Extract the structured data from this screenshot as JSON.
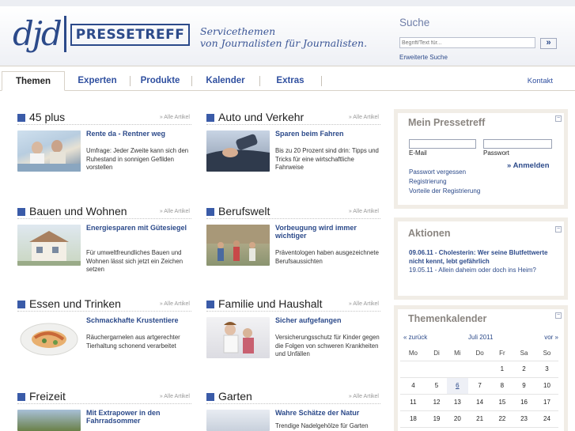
{
  "header": {
    "logo_djd": "djd",
    "logo_box": "PRESSETREFF",
    "tagline_1": "Servicethemen",
    "tagline_2": "von Journalisten für Journalisten.",
    "search_title": "Suche",
    "search_placeholder": "Begriff/Text für...",
    "search_button": "»",
    "extended_search": "Erweiterte Suche"
  },
  "nav": {
    "tabs": [
      {
        "label": "Themen"
      },
      {
        "label": "Experten"
      },
      {
        "label": "Produkte"
      },
      {
        "label": "Kalender"
      },
      {
        "label": "Extras"
      }
    ],
    "contact": "Kontakt"
  },
  "sections": [
    {
      "title": "45 plus",
      "all": "» Alle Artikel",
      "article_title": "Rente da - Rentner weg",
      "article_text": "Umfrage: Jeder Zweite kann sich den Ruhestand in sonnigen Gefilden vorstellen"
    },
    {
      "title": "Auto und Verkehr",
      "all": "» Alle Artikel",
      "article_title": "Sparen beim Fahren",
      "article_text": "Bis zu 20 Prozent sind drin: Tipps und Tricks für eine wirtschaftliche Fahrweise"
    },
    {
      "title": "Bauen und Wohnen",
      "all": "» Alle Artikel",
      "article_title": "Energiesparen mit Gütesiegel",
      "article_text": "Für umweltfreundliches Bauen und Wohnen lässt sich jetzt ein Zeichen setzen"
    },
    {
      "title": "Berufswelt",
      "all": "» Alle Artikel",
      "article_title": "Vorbeugung wird immer wichtiger",
      "article_text": "Präventologen haben ausgezeichnete Berufsaussichten"
    },
    {
      "title": "Essen und Trinken",
      "all": "» Alle Artikel",
      "article_title": "Schmackhafte Krustentiere",
      "article_text": "Räuchergarnelen aus artgerechter Tierhaltung schonend verarbeitet"
    },
    {
      "title": "Familie und Haushalt",
      "all": "» Alle Artikel",
      "article_title": "Sicher aufgefangen",
      "article_text": "Versicherungsschutz für Kinder gegen die Folgen von schweren Krankheiten und Unfällen"
    },
    {
      "title": "Freizeit",
      "all": "» Alle Artikel",
      "article_title": "Mit Extrapower in den Fahrradsommer",
      "article_text": ""
    },
    {
      "title": "Garten",
      "all": "» Alle Artikel",
      "article_title": "Wahre Schätze der Natur",
      "article_text": "Trendige Nadelgehölze für Garten"
    }
  ],
  "login": {
    "title": "Mein Pressetreff",
    "minimize": "−",
    "email_label": "E-Mail",
    "password_label": "Passwort",
    "submit": "» Anmelden",
    "forgot": "Passwort vergessen",
    "register": "Registrierung",
    "benefits": "Vorteile der Registrierung"
  },
  "actions": {
    "title": "Aktionen",
    "minimize": "−",
    "item1": "09.06.11 - Cholesterin: Wer seine Blutfettwerte nicht kennt, lebt gefährlich",
    "item2": "19.05.11 - Allein daheim oder doch ins Heim?"
  },
  "calendar": {
    "title": "Themenkalender",
    "minimize": "−",
    "prev": "« zurück",
    "month": "Juli 2011",
    "next": "vor »",
    "weekdays": [
      "Mo",
      "Di",
      "Mi",
      "Do",
      "Fr",
      "Sa",
      "So"
    ],
    "weeks": [
      [
        "",
        "",
        "",
        "",
        "1",
        "2",
        "3"
      ],
      [
        "4",
        "5",
        "6",
        "7",
        "8",
        "9",
        "10"
      ],
      [
        "11",
        "12",
        "13",
        "14",
        "15",
        "16",
        "17"
      ],
      [
        "18",
        "19",
        "20",
        "21",
        "22",
        "23",
        "24"
      ]
    ],
    "highlight_day": "6"
  },
  "colors": {
    "brand": "#2c4a8a",
    "accent_square": "#3a5ba8",
    "box_title": "#8a8580"
  }
}
